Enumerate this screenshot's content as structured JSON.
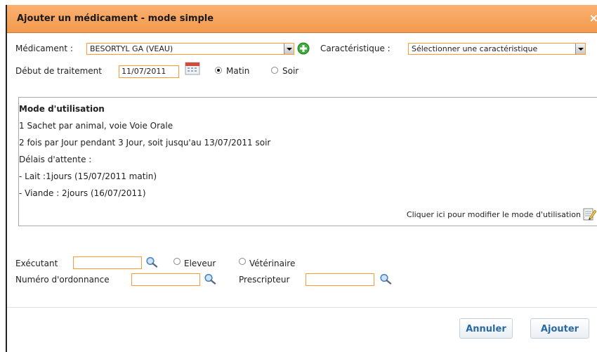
{
  "dialog": {
    "title": "Ajouter un médicament - mode simple",
    "close": "×"
  },
  "form": {
    "medicament_label": "Médicament :",
    "medicament_value": "BESORTYL GA (VEAU)",
    "caracteristique_label": "Caractéristique :",
    "caracteristique_value": "Sélectionner une caractéristique",
    "debut_label": "Début de traitement",
    "debut_value": "11/07/2011",
    "matin_label": "Matin",
    "soir_label": "Soir",
    "period_selected": "Matin"
  },
  "mode": {
    "title": "Mode d'utilisation",
    "lines": [
      "1 Sachet par animal, voie Voie Orale",
      "2 fois par Jour pendant 3 Jour, soit jusqu'au 13/07/2011 soir",
      "Délais d'attente :",
      "- Lait :1jours (15/07/2011 matin)",
      "- Viande : 2jours (16/07/2011)"
    ],
    "modify_link": "Cliquer ici pour modifier le mode d'utilisation"
  },
  "lower": {
    "executant_label": "Exécutant",
    "eleveur_label": "Eleveur",
    "veterinaire_label": "Vétérinaire",
    "ordonnance_label": "Numéro d'ordonnance",
    "prescripteur_label": "Prescripteur"
  },
  "buttons": {
    "cancel": "Annuler",
    "add": "Ajouter"
  },
  "colors": {
    "title_bar": "#f5a35c",
    "field_border": "#ff9933",
    "button_text": "#2a6aa3"
  }
}
